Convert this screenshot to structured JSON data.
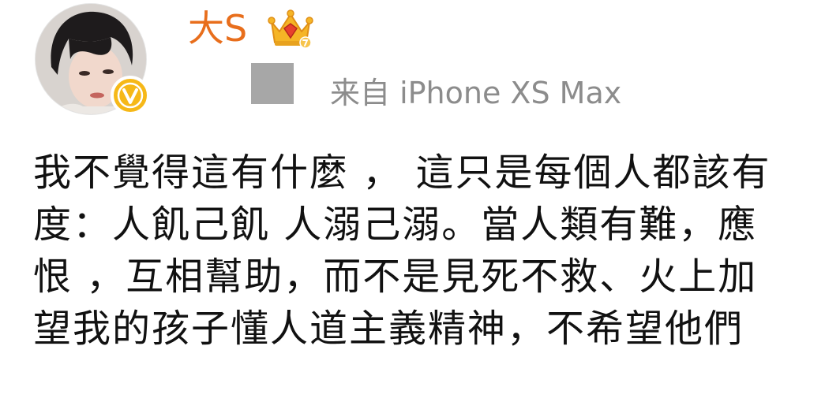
{
  "post": {
    "username": "大S",
    "source": "来自 iPhone XS Max",
    "body_lines": [
      "我不覺得這有什麼 ， 這只是每個人都該有",
      "度：人飢己飢 人溺己溺。當人類有難，應",
      "恨 ，互相幫助，而不是見死不救、火上加",
      "望我的孩子懂人道主義精神，不希望他們"
    ]
  },
  "icons": {
    "avatar": "profile-photo",
    "verified": "verified-v-badge",
    "crown": "crown-vip-icon",
    "pending": "gray-placeholder-square"
  },
  "colors": {
    "username": "#e86e1c",
    "source_text": "#8c8c8c",
    "body_text": "#111111",
    "badge": "#f6b818"
  }
}
